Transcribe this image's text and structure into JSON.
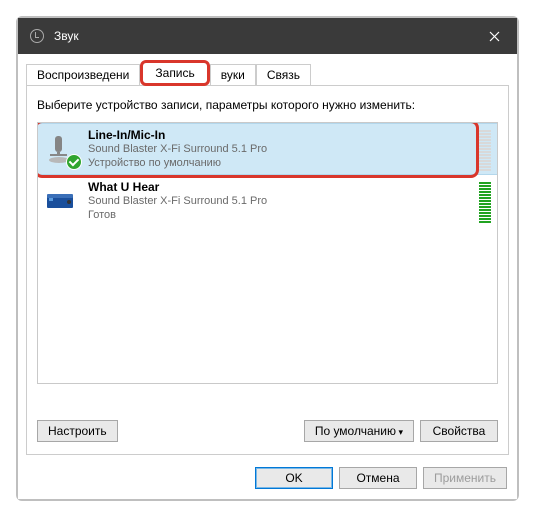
{
  "title": "Звук",
  "tabs": {
    "playback": "Воспроизведени",
    "recording": "Запись",
    "sounds": "вуки",
    "comms": "Связь"
  },
  "prompt": "Выберите устройство записи, параметры которого нужно изменить:",
  "devices": [
    {
      "name": "Line-In/Mic-In",
      "desc": "Sound Blaster X-Fi Surround 5.1 Pro",
      "status": "Устройство по умолчанию"
    },
    {
      "name": "What U Hear",
      "desc": "Sound Blaster X-Fi Surround 5.1 Pro",
      "status": "Готов"
    }
  ],
  "buttons": {
    "configure": "Настроить",
    "default": "По умолчанию",
    "properties": "Свойства",
    "ok": "OK",
    "cancel": "Отмена",
    "apply": "Применить"
  }
}
